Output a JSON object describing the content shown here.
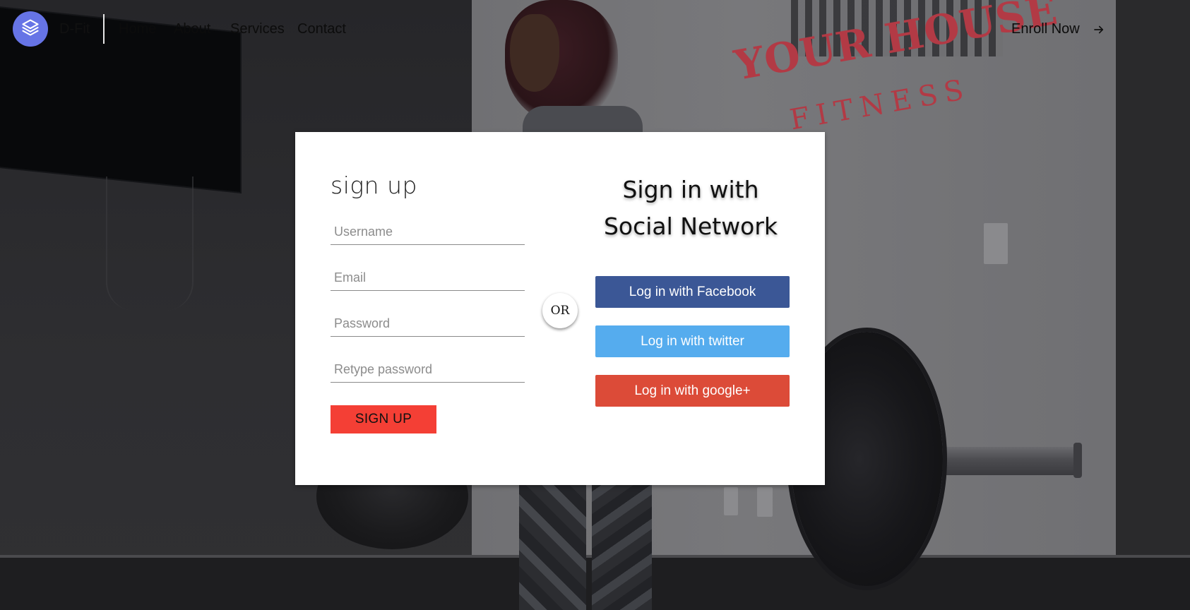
{
  "navbar": {
    "brand": "D-Fit",
    "links": [
      "Home",
      "About",
      "Services",
      "Contact"
    ],
    "enroll_label": "Enroll Now"
  },
  "background": {
    "sign_main": "YOUR HOUSE",
    "sign_sub": "FITNESS"
  },
  "signup": {
    "title": "sign up",
    "username_placeholder": "Username",
    "email_placeholder": "Email",
    "password_placeholder": "Password",
    "retype_placeholder": "Retype password",
    "submit_label": "SIGN UP"
  },
  "divider": {
    "or_label": "OR"
  },
  "social": {
    "title_line1": "Sign in with",
    "title_line2": "Social Network",
    "facebook_label": "Log in with Facebook",
    "twitter_label": "Log in with twitter",
    "google_label": "Log in with google+"
  },
  "colors": {
    "brand_logo": "#6674e6",
    "signup_button": "#f43f35",
    "facebook": "#3b5796",
    "twitter": "#55acee",
    "google": "#dc4b38"
  },
  "icons": {
    "brand": "layers-icon",
    "enroll": "arrow-right-icon"
  }
}
